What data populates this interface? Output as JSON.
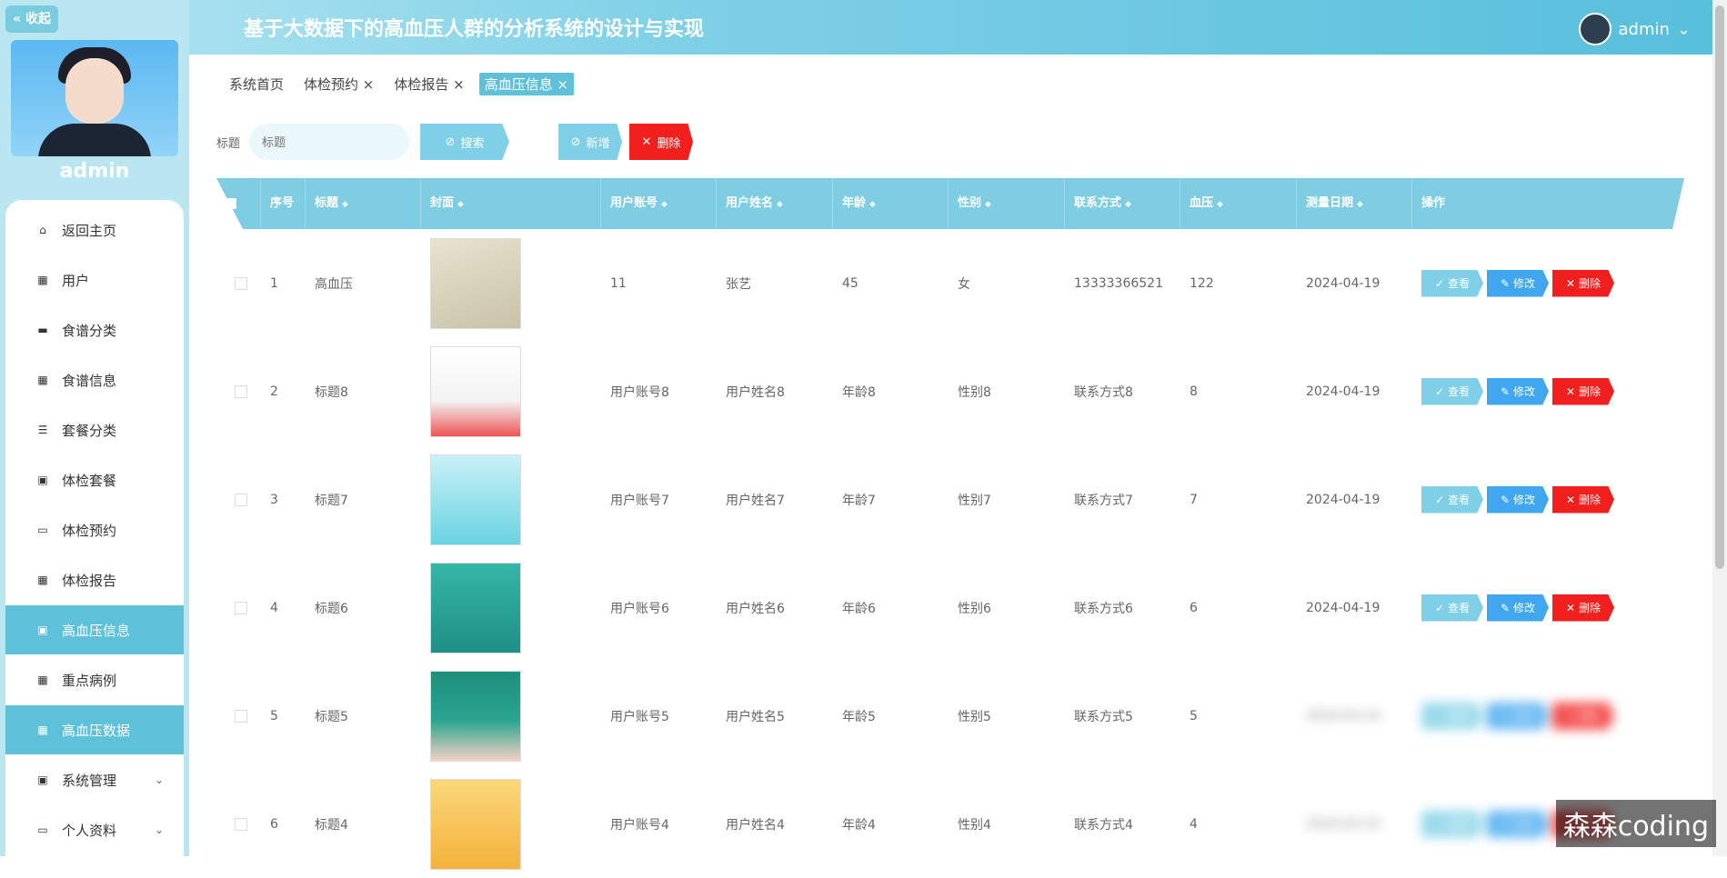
{
  "header": {
    "title": "基于大数据下的高血压人群的分析系统的设计与实现",
    "user": "admin"
  },
  "sidebar": {
    "collapse_label": "« 收起",
    "profile_name": "admin",
    "items": [
      {
        "label": "返回主页",
        "icon": "home-icon"
      },
      {
        "label": "用户",
        "icon": "grid-icon"
      },
      {
        "label": "食谱分类",
        "icon": "chat-icon"
      },
      {
        "label": "食谱信息",
        "icon": "grid-icon"
      },
      {
        "label": "套餐分类",
        "icon": "list-icon"
      },
      {
        "label": "体检套餐",
        "icon": "clipboard-icon"
      },
      {
        "label": "体检预约",
        "icon": "monitor-icon"
      },
      {
        "label": "体检报告",
        "icon": "grid-icon"
      },
      {
        "label": "高血压信息",
        "icon": "clipboard-icon"
      },
      {
        "label": "重点病例",
        "icon": "grid-icon"
      },
      {
        "label": "高血压数据",
        "icon": "grid-icon"
      },
      {
        "label": "系统管理",
        "icon": "clipboard-icon"
      },
      {
        "label": "个人资料",
        "icon": "card-icon"
      }
    ]
  },
  "tabs": [
    {
      "label": "系统首页"
    },
    {
      "label": "体检预约 ×"
    },
    {
      "label": "体检报告 ×"
    },
    {
      "label": "高血压信息 ×"
    }
  ],
  "search": {
    "label": "标题",
    "placeholder": "标题",
    "search_btn": "搜索",
    "add_btn": "新增",
    "delete_btn": "删除"
  },
  "table": {
    "headers": [
      "序号",
      "标题",
      "封面",
      "用户账号",
      "用户姓名",
      "年龄",
      "性别",
      "联系方式",
      "血压",
      "测量日期",
      "操作"
    ],
    "rows": [
      {
        "no": "1",
        "title": "高血压",
        "account": "11",
        "name": "张艺",
        "age": "45",
        "sex": "女",
        "phone": "13333366521",
        "bp": "122",
        "date": "2024-04-19"
      },
      {
        "no": "2",
        "title": "标题8",
        "account": "用户账号8",
        "name": "用户姓名8",
        "age": "年龄8",
        "sex": "性别8",
        "phone": "联系方式8",
        "bp": "8",
        "date": "2024-04-19"
      },
      {
        "no": "3",
        "title": "标题7",
        "account": "用户账号7",
        "name": "用户姓名7",
        "age": "年龄7",
        "sex": "性别7",
        "phone": "联系方式7",
        "bp": "7",
        "date": "2024-04-19"
      },
      {
        "no": "4",
        "title": "标题6",
        "account": "用户账号6",
        "name": "用户姓名6",
        "age": "年龄6",
        "sex": "性别6",
        "phone": "联系方式6",
        "bp": "6",
        "date": "2024-04-19"
      },
      {
        "no": "5",
        "title": "标题5",
        "account": "用户账号5",
        "name": "用户姓名5",
        "age": "年龄5",
        "sex": "性别5",
        "phone": "联系方式5",
        "bp": "5",
        "date": "2024-04-19"
      },
      {
        "no": "6",
        "title": "标题4",
        "account": "用户账号4",
        "name": "用户姓名4",
        "age": "年龄4",
        "sex": "性别4",
        "phone": "联系方式4",
        "bp": "4",
        "date": "2024-04-19"
      }
    ],
    "actions": {
      "view": "查看",
      "edit": "修改",
      "delete": "删除"
    }
  },
  "watermark": "森森coding"
}
